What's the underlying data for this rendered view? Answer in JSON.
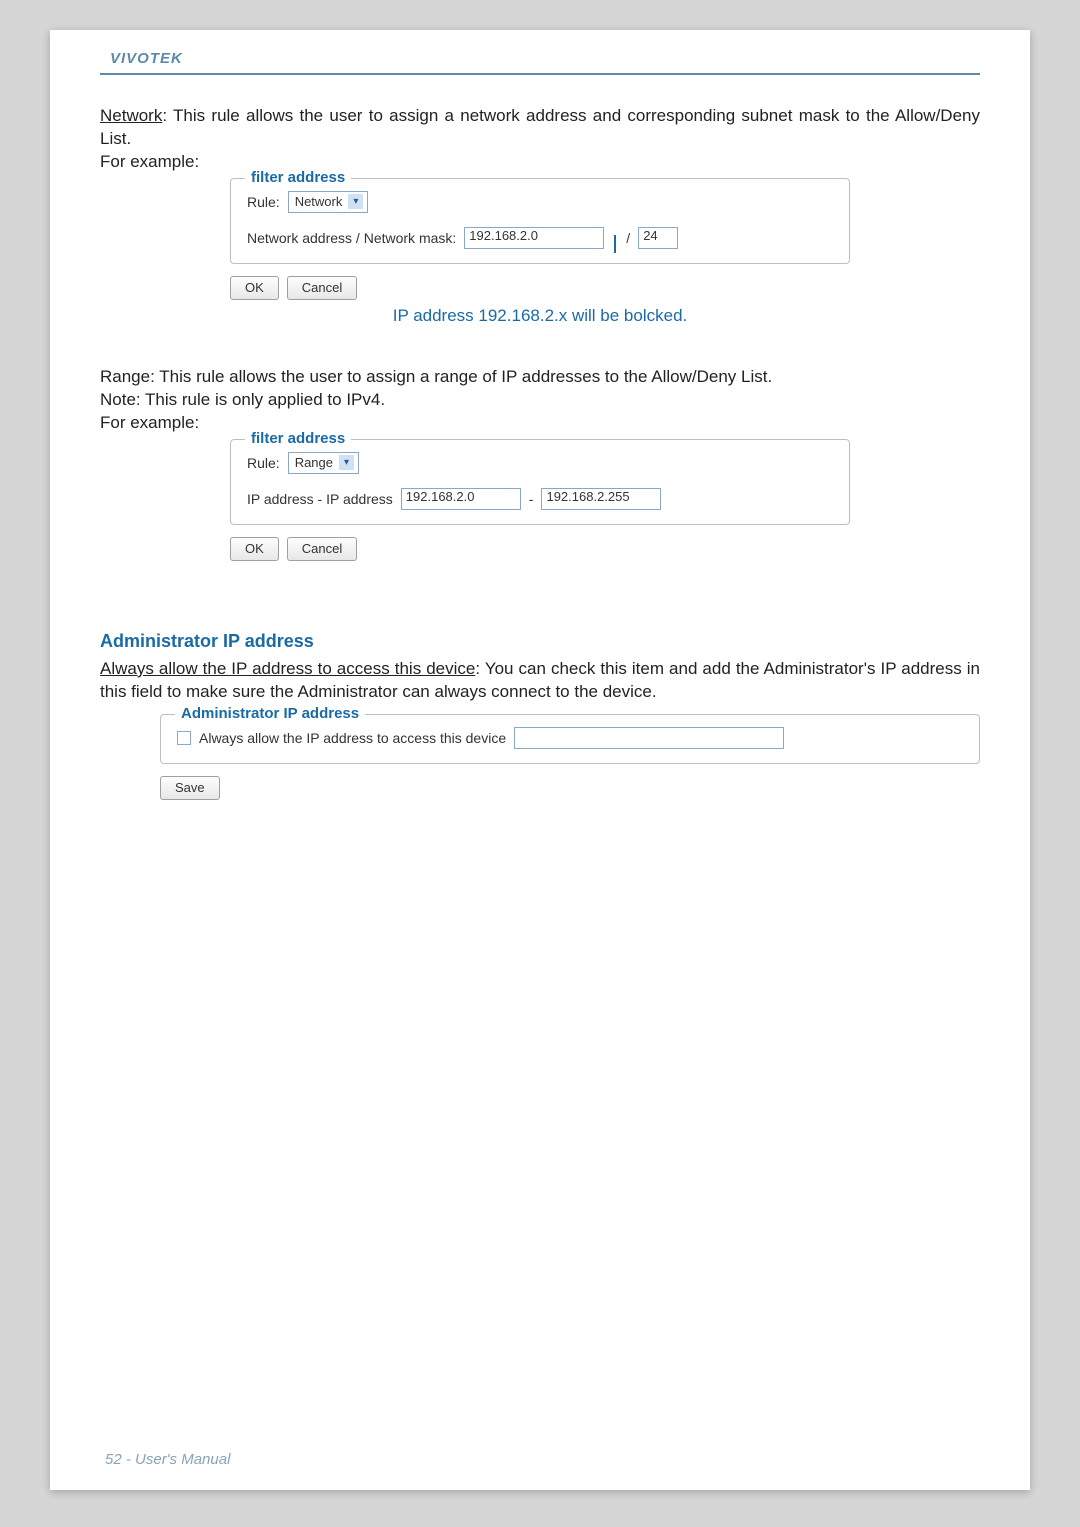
{
  "brand": "VIVOTEK",
  "para1": {
    "lead": "Network",
    "rest": ": This rule allows the user to assign a network address and corresponding subnet mask to the Allow/Deny List."
  },
  "for_example": "For example:",
  "filter1": {
    "legend": "filter address",
    "rule_label": "Rule:",
    "rule_value": "Network",
    "field_label": "Network address / Network mask:",
    "addr": "192.168.2.0",
    "slash": "/",
    "mask": "24",
    "ok": "OK",
    "cancel": "Cancel",
    "caption": "IP address 192.168.2.x will be bolcked."
  },
  "para2": {
    "line1": "Range: This rule allows the user to assign a range of IP addresses to the Allow/Deny List.",
    "line2": "Note: This rule is only applied to IPv4."
  },
  "filter2": {
    "legend": "filter address",
    "rule_label": "Rule:",
    "rule_value": "Range",
    "field_label": "IP address - IP address",
    "from": "192.168.2.0",
    "dash": "-",
    "to": "192.168.2.255",
    "ok": "OK",
    "cancel": "Cancel"
  },
  "admin": {
    "heading": "Administrator IP address",
    "lead": "Always allow the IP address to access this device",
    "rest": ": You can check this item and add the Administrator's IP address in this field to make sure the Administrator can always connect to the device.",
    "legend": "Administrator IP address",
    "checkbox_label": "Always allow the IP address to access this device",
    "save": "Save"
  },
  "footer": "52 - User's Manual"
}
